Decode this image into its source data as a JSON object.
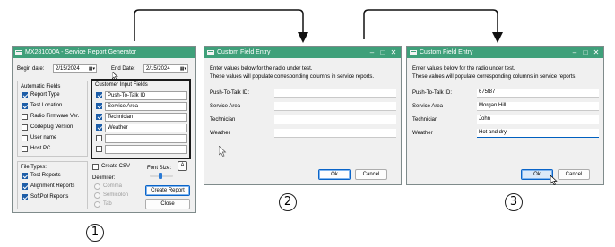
{
  "window1": {
    "title": "MX281000A - Service Report Generator",
    "begin_date_label": "Begin date:",
    "begin_date_value": "2/15/2024",
    "end_date_label": "End Date:",
    "end_date_value": "2/15/2024",
    "automatic_fields": {
      "title": "Automatic Fields",
      "items": [
        {
          "label": "Report Type",
          "checked": true
        },
        {
          "label": "Test Location",
          "checked": true
        },
        {
          "label": "Radio Firmware Ver.",
          "checked": false
        },
        {
          "label": "Codeplug Version",
          "checked": false
        },
        {
          "label": "User name",
          "checked": false
        },
        {
          "label": "Host PC",
          "checked": false
        }
      ]
    },
    "custom_fields": {
      "title": "Customer Input Fields",
      "items": [
        {
          "label": "Push-To-Talk ID",
          "checked": true
        },
        {
          "label": "Service Area",
          "checked": true
        },
        {
          "label": "Technician",
          "checked": true
        },
        {
          "label": "Weather",
          "checked": true
        },
        {
          "label": "",
          "checked": false
        },
        {
          "label": "",
          "checked": false
        }
      ]
    },
    "file_types": {
      "title": "File Types:",
      "items": [
        {
          "label": "Test Reports",
          "checked": true
        },
        {
          "label": "Alignment Reports",
          "checked": true
        },
        {
          "label": "SoftPot Reports",
          "checked": true
        }
      ]
    },
    "create_csv_label": "Create CSV",
    "delimiter_label": "Delimiter:",
    "delimiter_options": [
      "Comma",
      "Semicolon",
      "Tab"
    ],
    "font_size_label": "Font Size:",
    "font_size_button": "A",
    "create_report_button": "Create Report",
    "close_button": "Close"
  },
  "dialog2": {
    "title": "Custom Field Entry",
    "instruction_line1": "Enter values below for the radio under test.",
    "instruction_line2": "These values will populate corresponding columns in service reports.",
    "fields": [
      {
        "label": "Push-To-Talk ID:",
        "value": ""
      },
      {
        "label": "Service Area",
        "value": ""
      },
      {
        "label": "Technician",
        "value": ""
      },
      {
        "label": "Weather",
        "value": ""
      }
    ],
    "ok_button": "Ok",
    "cancel_button": "Cancel"
  },
  "dialog3": {
    "title": "Custom Field Entry",
    "instruction_line1": "Enter values below for the radio under test.",
    "instruction_line2": "These values will populate corresponding columns in service reports.",
    "fields": [
      {
        "label": "Push-To-Talk ID:",
        "value": "675f87"
      },
      {
        "label": "Service Area",
        "value": "Morgan Hill"
      },
      {
        "label": "Technician",
        "value": "John"
      },
      {
        "label": "Weather",
        "value": "Hot and dry"
      }
    ],
    "ok_button": "Ok",
    "cancel_button": "Cancel"
  },
  "step_labels": [
    "1",
    "2",
    "3"
  ],
  "colors": {
    "titlebar": "#3fa07a",
    "checkbox_checked": "#1e5ea8",
    "highlight_border": "#1a1a1a",
    "focus_underline": "#0060c0"
  },
  "icons": [
    "app-icon",
    "minimize-icon",
    "maximize-icon",
    "close-icon",
    "calendar-dropdown-icon",
    "mouse-pointer-icon",
    "flow-arrow-icon"
  ]
}
